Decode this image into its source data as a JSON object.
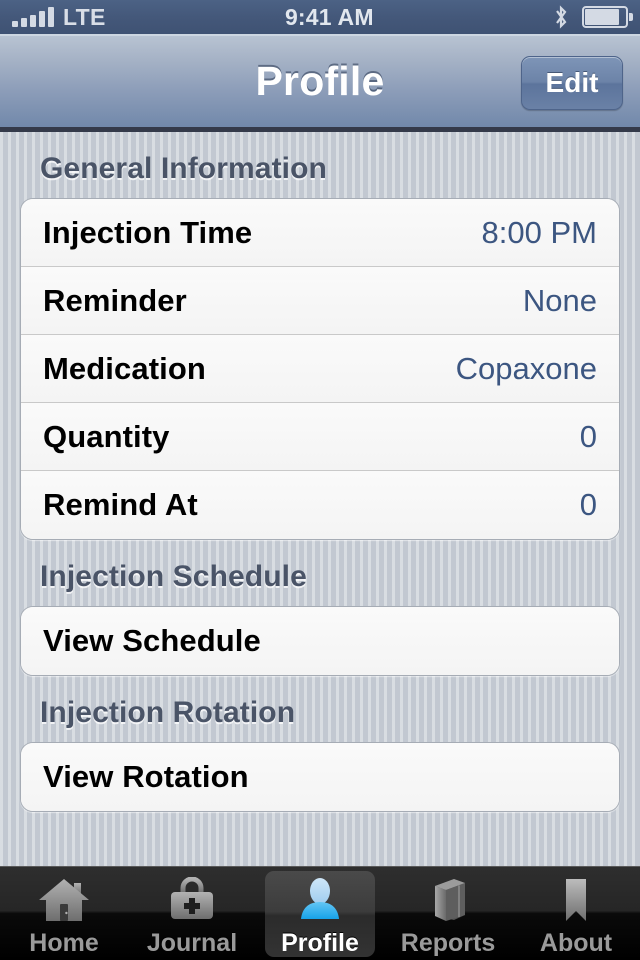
{
  "status_bar": {
    "carrier": "LTE",
    "time": "9:41 AM",
    "signal_bars": 5,
    "bluetooth_icon": "bluetooth-icon",
    "battery_icon": "battery-icon",
    "battery_level_pct": 85
  },
  "nav_bar": {
    "title": "Profile",
    "edit_label": "Edit"
  },
  "sections": [
    {
      "header": "General Information",
      "rows": [
        {
          "label": "Injection Time",
          "value": "8:00 PM"
        },
        {
          "label": "Reminder",
          "value": "None"
        },
        {
          "label": "Medication",
          "value": "Copaxone"
        },
        {
          "label": "Quantity",
          "value": "0"
        },
        {
          "label": "Remind At",
          "value": "0"
        }
      ]
    },
    {
      "header": "Injection Schedule",
      "rows": [
        {
          "label": "View Schedule",
          "value": ""
        }
      ]
    },
    {
      "header": "Injection Rotation",
      "rows": [
        {
          "label": "View Rotation",
          "value": ""
        }
      ]
    }
  ],
  "tab_bar": {
    "selected_index": 2,
    "tabs": [
      {
        "label": "Home",
        "icon": "house-icon"
      },
      {
        "label": "Journal",
        "icon": "medical-bag-icon"
      },
      {
        "label": "Profile",
        "icon": "person-icon"
      },
      {
        "label": "Reports",
        "icon": "book-icon"
      },
      {
        "label": "About",
        "icon": "bookmark-icon"
      }
    ]
  },
  "colors": {
    "nav_bar_top": "#b8c3d2",
    "nav_bar_bottom": "#7289ab",
    "status_bar": "#44587a",
    "value_text": "#3c5681",
    "section_header_text": "#4a5467",
    "content_background": "#c8ced6",
    "tab_bar_background": "#000000",
    "tab_active_icon": "#3fb9f0"
  }
}
